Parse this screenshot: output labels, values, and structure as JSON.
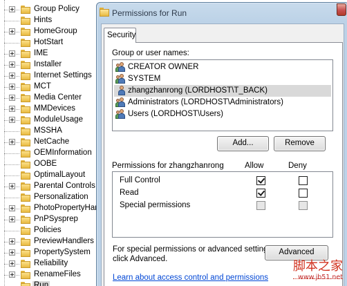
{
  "tree": {
    "items": [
      {
        "label": "Group Policy"
      },
      {
        "label": "Hints"
      },
      {
        "label": "HomeGroup"
      },
      {
        "label": "HotStart"
      },
      {
        "label": "IME"
      },
      {
        "label": "Installer"
      },
      {
        "label": "Internet Settings"
      },
      {
        "label": "MCT"
      },
      {
        "label": "Media Center"
      },
      {
        "label": "MMDevices"
      },
      {
        "label": "ModuleUsage"
      },
      {
        "label": "MSSHA"
      },
      {
        "label": "NetCache"
      },
      {
        "label": "OEMInformation"
      },
      {
        "label": "OOBE"
      },
      {
        "label": "OptimalLayout"
      },
      {
        "label": "Parental Controls"
      },
      {
        "label": "Personalization"
      },
      {
        "label": "PhotoPropertyHan"
      },
      {
        "label": "PnPSysprep"
      },
      {
        "label": "Policies"
      },
      {
        "label": "PreviewHandlers"
      },
      {
        "label": "PropertySystem"
      },
      {
        "label": "Reliability"
      },
      {
        "label": "RenameFiles"
      },
      {
        "label": "Run"
      }
    ]
  },
  "dialog": {
    "title": "Permissions for Run",
    "tab_label": "Security",
    "group_label": "Group or user names:",
    "users": [
      {
        "name": "CREATOR OWNER",
        "icon": "group-icon"
      },
      {
        "name": "SYSTEM",
        "icon": "group-icon"
      },
      {
        "name": "zhangzhanrong (LORDHOST\\T_BACK)",
        "icon": "user-icon",
        "selected": true
      },
      {
        "name": "Administrators (LORDHOST\\Administrators)",
        "icon": "group-icon"
      },
      {
        "name": "Users (LORDHOST\\Users)",
        "icon": "group-icon"
      }
    ],
    "add_button": "Add...",
    "remove_button": "Remove",
    "permissions_for_label": "Permissions for zhangzhanrong",
    "allow_header": "Allow",
    "deny_header": "Deny",
    "permissions": [
      {
        "name": "Full Control",
        "allow": true,
        "deny": false,
        "enabled": true
      },
      {
        "name": "Read",
        "allow": true,
        "deny": false,
        "enabled": true
      },
      {
        "name": "Special permissions",
        "allow": false,
        "deny": false,
        "enabled": false
      }
    ],
    "special_text_line1": "For special permissions or advanced settings,",
    "special_text_line2": "click Advanced.",
    "advanced_button": "Advanced",
    "learn_link": "Learn about access control and permissions"
  },
  "watermark": {
    "main": "脚本之家",
    "sub": "www.jb51.net"
  },
  "colors": {
    "link": "#0046d5",
    "selection": "#d9d9d9",
    "dialog_frame": "#bcd2e7",
    "watermark": "#d1321f"
  }
}
